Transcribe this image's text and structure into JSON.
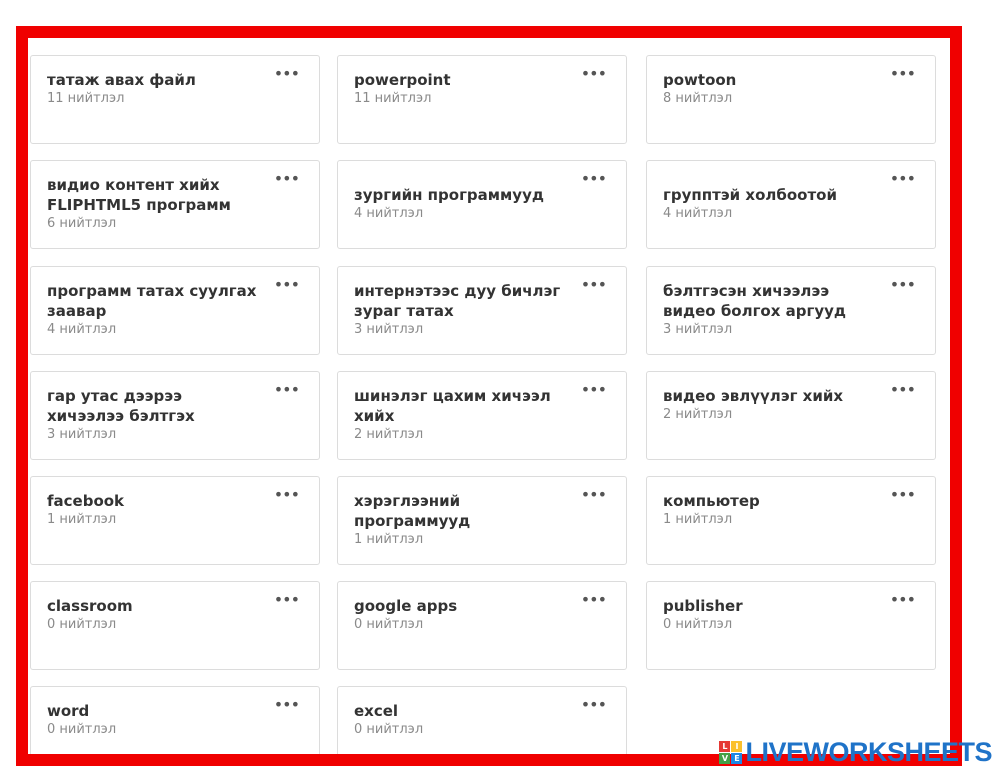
{
  "board": {
    "cards": [
      {
        "title": "татаж авах файл",
        "count": "11 нийтлэл"
      },
      {
        "title": "powerpoint",
        "count": "11 нийтлэл"
      },
      {
        "title": "powtoon",
        "count": "8 нийтлэл"
      },
      {
        "title": "видио контент хийх FLIPHTML5 программ",
        "count": "6 нийтлэл"
      },
      {
        "title": "зургийн программууд",
        "count": "4 нийтлэл"
      },
      {
        "title": "групптэй холбоотой",
        "count": "4 нийтлэл"
      },
      {
        "title": "программ татах суулгах заавар",
        "count": "4 нийтлэл"
      },
      {
        "title": "интернэтээс дуу бичлэг зураг татах",
        "count": "3 нийтлэл"
      },
      {
        "title": "бэлтгэсэн хичээлээ видео болгох аргууд",
        "count": "3 нийтлэл"
      },
      {
        "title": "гар утас дээрээ хичээлээ бэлтгэх",
        "count": "3 нийтлэл"
      },
      {
        "title": "шинэлэг цахим хичээл хийх",
        "count": "2 нийтлэл"
      },
      {
        "title": "видео эвлүүлэг хийх",
        "count": "2 нийтлэл"
      },
      {
        "title": "facebook",
        "count": "1 нийтлэл"
      },
      {
        "title": "хэрэглээний программууд",
        "count": "1 нийтлэл"
      },
      {
        "title": "компьютер",
        "count": "1 нийтлэл"
      },
      {
        "title": "classroom",
        "count": "0 нийтлэл"
      },
      {
        "title": "google apps",
        "count": "0 нийтлэл"
      },
      {
        "title": "publisher",
        "count": "0 нийтлэл"
      },
      {
        "title": "word",
        "count": "0 нийтлэл"
      },
      {
        "title": "excel",
        "count": "0 нийтлэл"
      }
    ],
    "menu_glyph": "•••"
  },
  "watermark": {
    "text": "LIVEWORKSHEETS",
    "mark_letters": [
      "L",
      "I",
      "V",
      "E"
    ],
    "mark_colors": [
      "#e53935",
      "#fbc02d",
      "#43a047",
      "#1e88e5"
    ],
    "text_color": "#1f73c8"
  },
  "colors": {
    "frame_border": "#f00000",
    "card_border": "#dcdcdc",
    "title": "#333333",
    "count": "#8a8a8a"
  }
}
